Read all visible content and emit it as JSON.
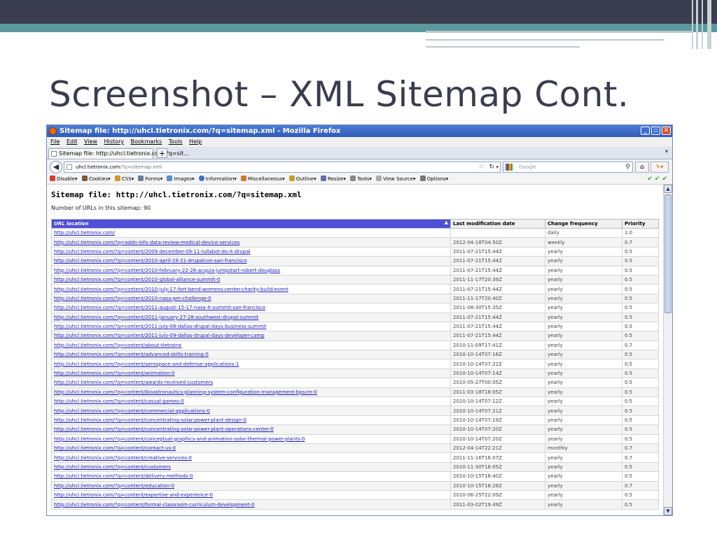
{
  "slide": {
    "title": "Screenshot – XML Sitemap Cont."
  },
  "browser": {
    "window_title": "Sitemap file: http://uhcl.tietronix.com/?q=sitemap.xml - Mozilla Firefox",
    "menu": [
      "File",
      "Edit",
      "View",
      "History",
      "Bookmarks",
      "Tools",
      "Help"
    ],
    "tab_label": "Sitemap file: http://uhcl.tietronix.com/?q=sit...",
    "url_host": "uhcl.tietronix.com",
    "url_path": "/?q=sitemap.xml",
    "search_placeholder": "Google",
    "devbar": [
      "Disable",
      "Cookies",
      "CSS",
      "Forms",
      "Images",
      "Information",
      "Miscellaneous",
      "Outline",
      "Resize",
      "Tools",
      "View Source",
      "Options"
    ],
    "devbar_icon_colors": [
      "#d43c2a",
      "#7a5a3a",
      "#c89a2a",
      "#6a7a9a",
      "#5a8ad0",
      "#3a6ec8",
      "#c87a2a",
      "#c8a02a",
      "#6a6aa8",
      "#888888",
      "#aaaaaa",
      "#777777"
    ]
  },
  "sitemap": {
    "heading": "Sitemap file: http://uhcl.tietronix.com/?q=sitemap.xml",
    "count_text": "Number of URLs in this sitemap: 90",
    "columns": [
      "URL location",
      "Last modification date",
      "Change frequency",
      "Priority"
    ],
    "header_color": "#4f4fd8",
    "rows": [
      [
        "http://uhcl.tietronix.com/",
        "",
        "daily",
        "1.0"
      ],
      [
        "http://uhcl.tietronix.com/?q=addn-info-data-review-medical-device-services",
        "2012-04-18T04:50Z",
        "weekly",
        "0.7"
      ],
      [
        "http://uhcl.tietronix.com/?q=content/2009-december-09-11-lullabot-do-it-drupal",
        "2011-07-21T15:44Z",
        "yearly",
        "0.5"
      ],
      [
        "http://uhcl.tietronix.com/?q=content/2010-april-19-21-drupalcon-san-francisco",
        "2011-07-21T15:44Z",
        "yearly",
        "0.5"
      ],
      [
        "http://uhcl.tietronix.com/?q=content/2010-february-22-26-acquia-jumpstart-robert-douglass",
        "2011-07-21T15:44Z",
        "yearly",
        "0.5"
      ],
      [
        "http://uhcl.tietronix.com/?q=content/2010-global-alliance-summit-0",
        "2011-11-17T20:39Z",
        "yearly",
        "0.5"
      ],
      [
        "http://uhcl.tietronix.com/?q=content/2010-july-17-fort-bend-womens-center-charity-build-event",
        "2011-07-21T15:44Z",
        "yearly",
        "0.5"
      ],
      [
        "http://uhcl.tietronix.com/?q=content/2010-nasa-pm-challenge-0",
        "2011-11-17T20:40Z",
        "yearly",
        "0.5"
      ],
      [
        "http://uhcl.tietronix.com/?q=content/2011-august-15-17-nasa-it-summit-san-francisco",
        "2011-08-30T15:35Z",
        "yearly",
        "0.5"
      ],
      [
        "http://uhcl.tietronix.com/?q=content/2011-january-27-28-southwest-drupal-summit",
        "2011-07-21T15:44Z",
        "yearly",
        "0.5"
      ],
      [
        "http://uhcl.tietronix.com/?q=content/2011-july-08-dallas-drupal-days-business-summit",
        "2011-07-21T15:44Z",
        "yearly",
        "0.5"
      ],
      [
        "http://uhcl.tietronix.com/?q=content/2011-july-09-dallas-drupal-days-developer-camp",
        "2011-07-21T15:44Z",
        "yearly",
        "0.5"
      ],
      [
        "http://uhcl.tietronix.com/?q=content/about-tietroinx",
        "2010-11-09T17:41Z",
        "yearly",
        "0.7"
      ],
      [
        "http://uhcl.tietronix.com/?q=content/advanced-skills-training-0",
        "2010-10-14T07:16Z",
        "yearly",
        "0.5"
      ],
      [
        "http://uhcl.tietronix.com/?q=content/aerospace-and-defense-applications-1",
        "2010-10-14T07:22Z",
        "yearly",
        "0.5"
      ],
      [
        "http://uhcl.tietronix.com/?q=content/animation-0",
        "2010-10-14T07:14Z",
        "yearly",
        "0.5"
      ],
      [
        "http://uhcl.tietronix.com/?q=content/awards-received-customers",
        "2010-05-27T00:05Z",
        "yearly",
        "0.5"
      ],
      [
        "http://uhcl.tietronix.com/?q=content/bioastronautics-planning-system-configuration-management-bpscm-0",
        "2011-03-18T18:05Z",
        "yearly",
        "0.5"
      ],
      [
        "http://uhcl.tietronix.com/?q=content/casual-games-0",
        "2010-10-14T07:12Z",
        "yearly",
        "0.5"
      ],
      [
        "http://uhcl.tietronix.com/?q=content/commercial-applications-0",
        "2010-10-14T07:21Z",
        "yearly",
        "0.5"
      ],
      [
        "http://uhcl.tietronix.com/?q=content/concentrating-solar-power-plant-design-0",
        "2010-10-14T07:19Z",
        "yearly",
        "0.5"
      ],
      [
        "http://uhcl.tietronix.com/?q=content/concentrating-solar-power-plant-operations-center-0",
        "2010-10-14T07:20Z",
        "yearly",
        "0.5"
      ],
      [
        "http://uhcl.tietronix.com/?q=content/conceptual-graphics-and-animation-solar-thermal-power-plants-0",
        "2010-10-14T07:20Z",
        "yearly",
        "0.5"
      ],
      [
        "http://uhcl.tietronix.com/?q=content/contact-us-0",
        "2012-04-14T22:21Z",
        "monthly",
        "0.7"
      ],
      [
        "http://uhcl.tietronix.com/?q=content/creative-services-0",
        "2011-11-16T16:07Z",
        "yearly",
        "0.7"
      ],
      [
        "http://uhcl.tietronix.com/?q=content/customers",
        "2010-11-30T18:05Z",
        "yearly",
        "0.5"
      ],
      [
        "http://uhcl.tietronix.com/?q=content/delivery-methods-0",
        "2010-10-15T18:40Z",
        "yearly",
        "0.5"
      ],
      [
        "http://uhcl.tietronix.com/?q=content/education-0",
        "2010-10-15T18:28Z",
        "yearly",
        "0.7"
      ],
      [
        "http://uhcl.tietronix.com/?q=content/expertise-and-experience-0",
        "2010-06-25T22:09Z",
        "yearly",
        "0.5"
      ],
      [
        "http://uhcl.tietronix.com/?q=content/formal-classroom-curriculum-development-0",
        "2011-03-02T19:49Z",
        "yearly",
        "0.5"
      ]
    ]
  }
}
